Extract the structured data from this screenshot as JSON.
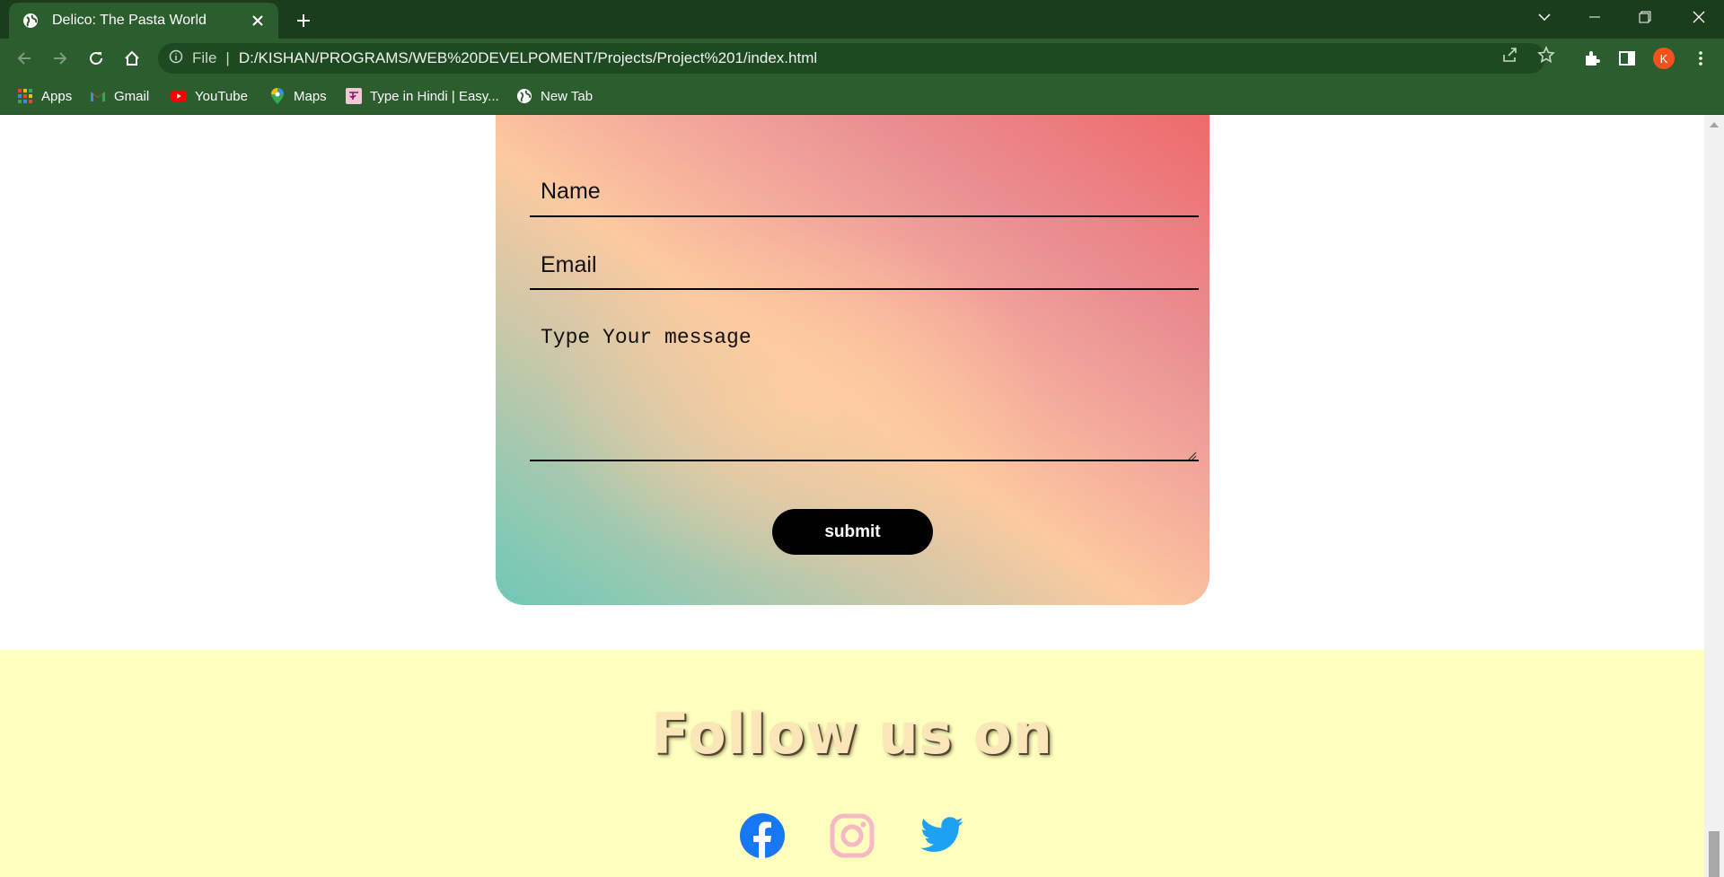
{
  "browser": {
    "tab_title": "Delico: The Pasta World",
    "file_label": "File",
    "url": "D:/KISHAN/PROGRAMS/WEB%20DEVELPOMENT/Projects/Project%201/index.html",
    "profile_initial": "K",
    "profile_color": "#f4511e",
    "chrome_color": "#2b5d2e",
    "bookmarks": [
      {
        "label": "Apps",
        "icon": "apps-grid-icon"
      },
      {
        "label": "Gmail",
        "icon": "gmail-icon"
      },
      {
        "label": "YouTube",
        "icon": "youtube-icon"
      },
      {
        "label": "Maps",
        "icon": "maps-icon"
      },
      {
        "label": "Type in Hindi | Easy...",
        "icon": "hindi-icon"
      },
      {
        "label": "New Tab",
        "icon": "globe-icon"
      }
    ]
  },
  "form": {
    "name_placeholder": "Name",
    "email_placeholder": "Email",
    "message_placeholder": "Type Your message",
    "submit_label": "submit"
  },
  "footer": {
    "title": "Follow us on",
    "background": "#ffffbe",
    "socials": [
      {
        "name": "facebook",
        "color": "#1877f2"
      },
      {
        "name": "instagram",
        "color": "#f7b8c6"
      },
      {
        "name": "twitter",
        "color": "#1da1f2"
      }
    ]
  }
}
